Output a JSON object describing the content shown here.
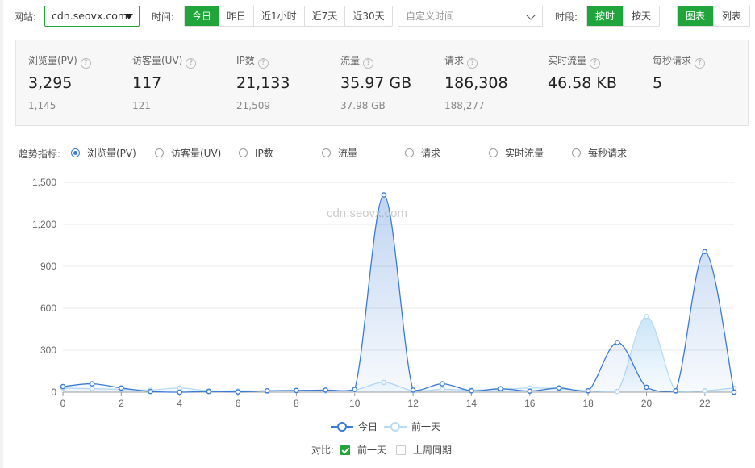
{
  "filter": {
    "site_label": "网站:",
    "site_value": "cdn.seovx.com",
    "time_label": "时间:",
    "time_options": [
      "今日",
      "昨日",
      "近1小时",
      "近7天",
      "近30天"
    ],
    "time_selected": 0,
    "custom_time_placeholder": "自定义时间",
    "period_label": "时段:",
    "period_options": [
      "按时",
      "按天"
    ],
    "period_selected": 0,
    "view_options": [
      "图表",
      "列表"
    ],
    "view_selected": 0
  },
  "stats": [
    {
      "label": "浏览量(PV)",
      "value": "3,295",
      "prev": "1,145"
    },
    {
      "label": "访客量(UV)",
      "value": "117",
      "prev": "121"
    },
    {
      "label": "IP数",
      "value": "21,133",
      "prev": "21,509"
    },
    {
      "label": "流量",
      "value": "35.97 GB",
      "prev": "37.98 GB"
    },
    {
      "label": "请求",
      "value": "186,308",
      "prev": "188,277"
    },
    {
      "label": "实时流量",
      "value": "46.58 KB",
      "prev": ""
    },
    {
      "label": "每秒请求",
      "value": "5",
      "prev": ""
    }
  ],
  "indicators": {
    "label": "趋势指标:",
    "options": [
      "浏览量(PV)",
      "访客量(UV)",
      "IP数",
      "流量",
      "请求",
      "实时流量",
      "每秒请求"
    ],
    "selected": 0
  },
  "compare": {
    "label": "对比:",
    "options": [
      {
        "label": "前一天",
        "checked": true
      },
      {
        "label": "上周同期",
        "checked": false
      }
    ]
  },
  "colors": {
    "accent": "#20a53a",
    "today": "#3a7bd5",
    "prev_day": "#b7daf5"
  },
  "chart_data": {
    "type": "area",
    "watermark": "cdn.seovx.com",
    "x": [
      0,
      1,
      2,
      3,
      4,
      5,
      6,
      7,
      8,
      9,
      10,
      11,
      12,
      13,
      14,
      15,
      16,
      17,
      18,
      19,
      20,
      21,
      22,
      23
    ],
    "x_ticks": [
      0,
      2,
      4,
      6,
      8,
      10,
      12,
      14,
      16,
      18,
      20,
      22
    ],
    "y_ticks": [
      "0",
      "300",
      "600",
      "900",
      "1,200",
      "1,500"
    ],
    "ylim": [
      0,
      1500
    ],
    "grid": true,
    "legend_position": "bottom",
    "series": [
      {
        "name": "今日",
        "values": [
          40,
          60,
          30,
          5,
          0,
          5,
          2,
          10,
          12,
          15,
          20,
          1410,
          15,
          60,
          10,
          25,
          8,
          30,
          10,
          355,
          35,
          10,
          1005,
          0
        ]
      },
      {
        "name": "前一天",
        "values": [
          30,
          25,
          20,
          15,
          30,
          10,
          10,
          8,
          12,
          10,
          15,
          70,
          10,
          20,
          15,
          20,
          30,
          25,
          10,
          5,
          540,
          8,
          10,
          30
        ]
      }
    ]
  }
}
